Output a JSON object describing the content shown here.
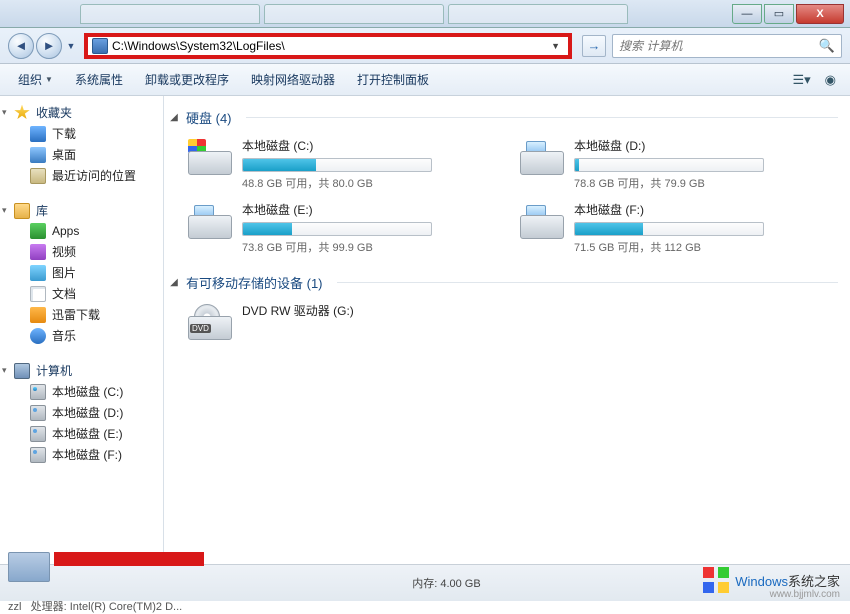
{
  "window": {
    "minimize": "—",
    "maximize": "▭",
    "close": "X"
  },
  "nav": {
    "back": "◄",
    "forward": "►",
    "dropdown": "▼",
    "address": "C:\\Windows\\System32\\LogFiles\\",
    "go": "→",
    "search_placeholder": "搜索 计算机"
  },
  "toolbar": {
    "organize": "组织",
    "system_props": "系统属性",
    "uninstall": "卸载或更改程序",
    "map_drive": "映射网络驱动器",
    "control_panel": "打开控制面板"
  },
  "sidebar": {
    "favorites": {
      "label": "收藏夹"
    },
    "downloads": "下载",
    "desktop": "桌面",
    "recent": "最近访问的位置",
    "libraries": {
      "label": "库"
    },
    "apps": "Apps",
    "videos": "视频",
    "pictures": "图片",
    "documents": "文档",
    "xunlei": "迅雷下载",
    "music": "音乐",
    "computer": {
      "label": "计算机"
    },
    "drive_c": "本地磁盘 (C:)",
    "drive_d": "本地磁盘 (D:)",
    "drive_e": "本地磁盘 (E:)",
    "drive_f": "本地磁盘 (F:)"
  },
  "sections": {
    "drives_label": "硬盘 (4)",
    "removable_label": "有可移动存储的设备 (1)"
  },
  "drives": {
    "c": {
      "name": "本地磁盘 (C:)",
      "stat": "48.8 GB 可用，共 80.0 GB",
      "used_pct": 39
    },
    "d": {
      "name": "本地磁盘 (D:)",
      "stat": "78.8 GB 可用，共 79.9 GB",
      "used_pct": 2
    },
    "e": {
      "name": "本地磁盘 (E:)",
      "stat": "73.8 GB 可用，共 99.9 GB",
      "used_pct": 26
    },
    "f": {
      "name": "本地磁盘 (F:)",
      "stat": "71.5 GB 可用，共 112 GB",
      "used_pct": 36
    }
  },
  "dvd": {
    "name": "DVD RW 驱动器 (G:)",
    "badge": "DVD"
  },
  "status": {
    "user": "zzl",
    "cpu_label": "处理器:",
    "cpu": "Intel(R) Core(TM)2 D...",
    "ram_label": "内存:",
    "ram": "4.00 GB"
  },
  "watermark": {
    "brand": "Windows",
    "suffix": "系统之家",
    "url": "www.bjjmlv.com"
  }
}
